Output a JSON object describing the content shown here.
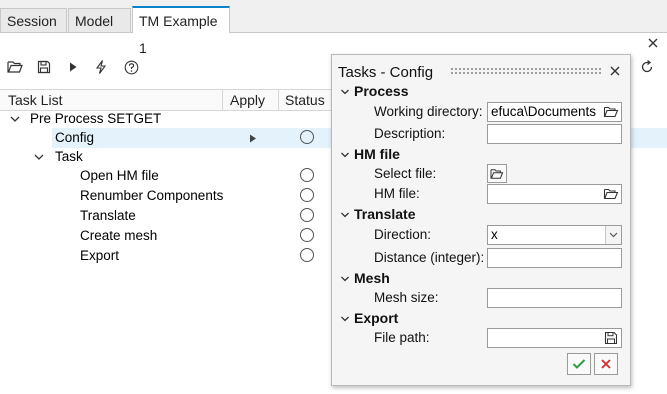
{
  "tabs": [
    {
      "label": "Session"
    },
    {
      "label": "Model"
    },
    {
      "label": "TM Example 1",
      "active": true
    }
  ],
  "toolbar": {
    "icons": [
      "open-folder-icon",
      "save-icon",
      "play-icon",
      "lightning-icon",
      "help-icon"
    ]
  },
  "tree": {
    "columns": {
      "task_list": "Task List",
      "apply": "Apply",
      "status": "Status"
    },
    "root": {
      "label": "Pre Process SETGET"
    },
    "config": {
      "label": "Config"
    },
    "task": {
      "label": "Task"
    },
    "children": [
      {
        "label": "Open HM file"
      },
      {
        "label": "Renumber Components"
      },
      {
        "label": "Translate"
      },
      {
        "label": "Create mesh"
      },
      {
        "label": "Export"
      }
    ]
  },
  "dialog": {
    "title": "Tasks - Config",
    "sections": {
      "process": {
        "title": "Process",
        "working_directory_label": "Working directory:",
        "working_directory_value": "efuca\\Documents",
        "description_label": "Description:",
        "description_value": ""
      },
      "hm_file": {
        "title": "HM file",
        "select_file_label": "Select file:",
        "hm_file_label": "HM file:",
        "hm_file_value": ""
      },
      "translate": {
        "title": "Translate",
        "direction_label": "Direction:",
        "direction_value": "x",
        "distance_label": "Distance (integer):",
        "distance_value": ""
      },
      "mesh": {
        "title": "Mesh",
        "mesh_size_label": "Mesh size:",
        "mesh_size_value": ""
      },
      "export": {
        "title": "Export",
        "file_path_label": "File path:",
        "file_path_value": ""
      }
    }
  },
  "colors": {
    "accent": "#0a84c8",
    "selected_row": "#e3f2fb",
    "confirm": "#2e9e3e",
    "cancel": "#d42b2b"
  }
}
